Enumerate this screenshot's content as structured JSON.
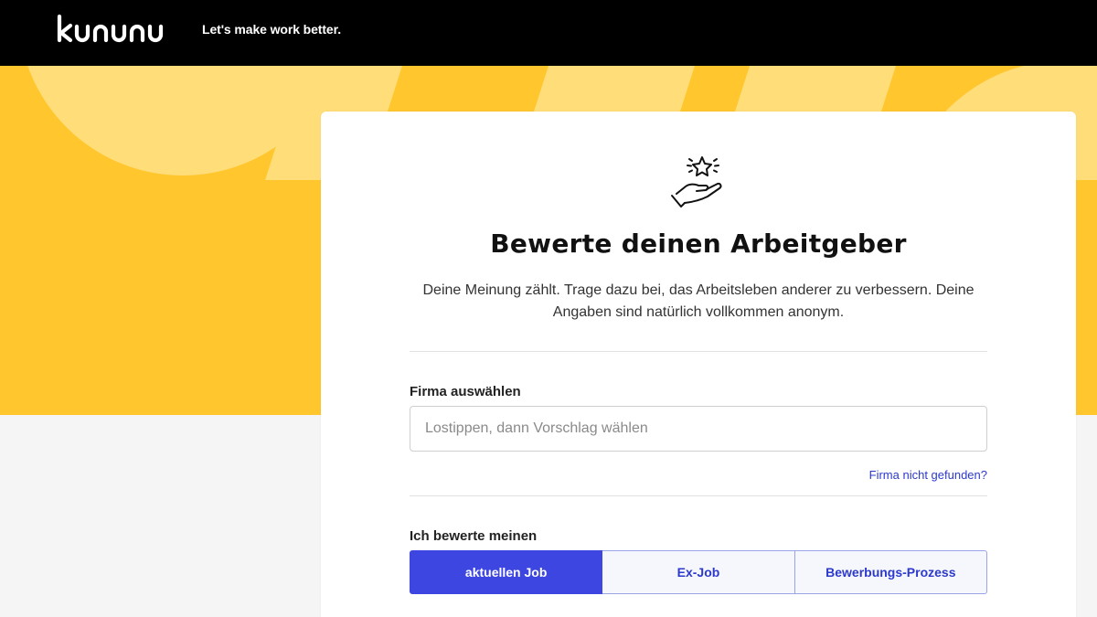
{
  "header": {
    "logo_text": "kununu",
    "tagline": "Let's make work better."
  },
  "colors": {
    "hero_yellow": "#ffc62e",
    "hero_light": "#ffdd78",
    "accent_blue": "#3d46e0",
    "link_blue": "#2c39cc"
  },
  "card": {
    "icon": "hand-star-icon",
    "title": "Bewerte deinen Arbeitgeber",
    "intro": "Deine Meinung zählt. Trage dazu bei, das Arbeitsleben anderer zu verbessern. Deine Angaben sind natürlich vollkommen anonym.",
    "company_label": "Firma auswählen",
    "company_placeholder": "Lostippen, dann Vorschlag wählen",
    "company_value": "",
    "not_found_link": "Firma nicht gefunden?",
    "rating_label": "Ich bewerte meinen",
    "rating_options": [
      {
        "label": "aktuellen Job",
        "selected": true
      },
      {
        "label": "Ex-Job",
        "selected": false
      },
      {
        "label": "Bewerbungs-Prozess",
        "selected": false
      }
    ]
  }
}
